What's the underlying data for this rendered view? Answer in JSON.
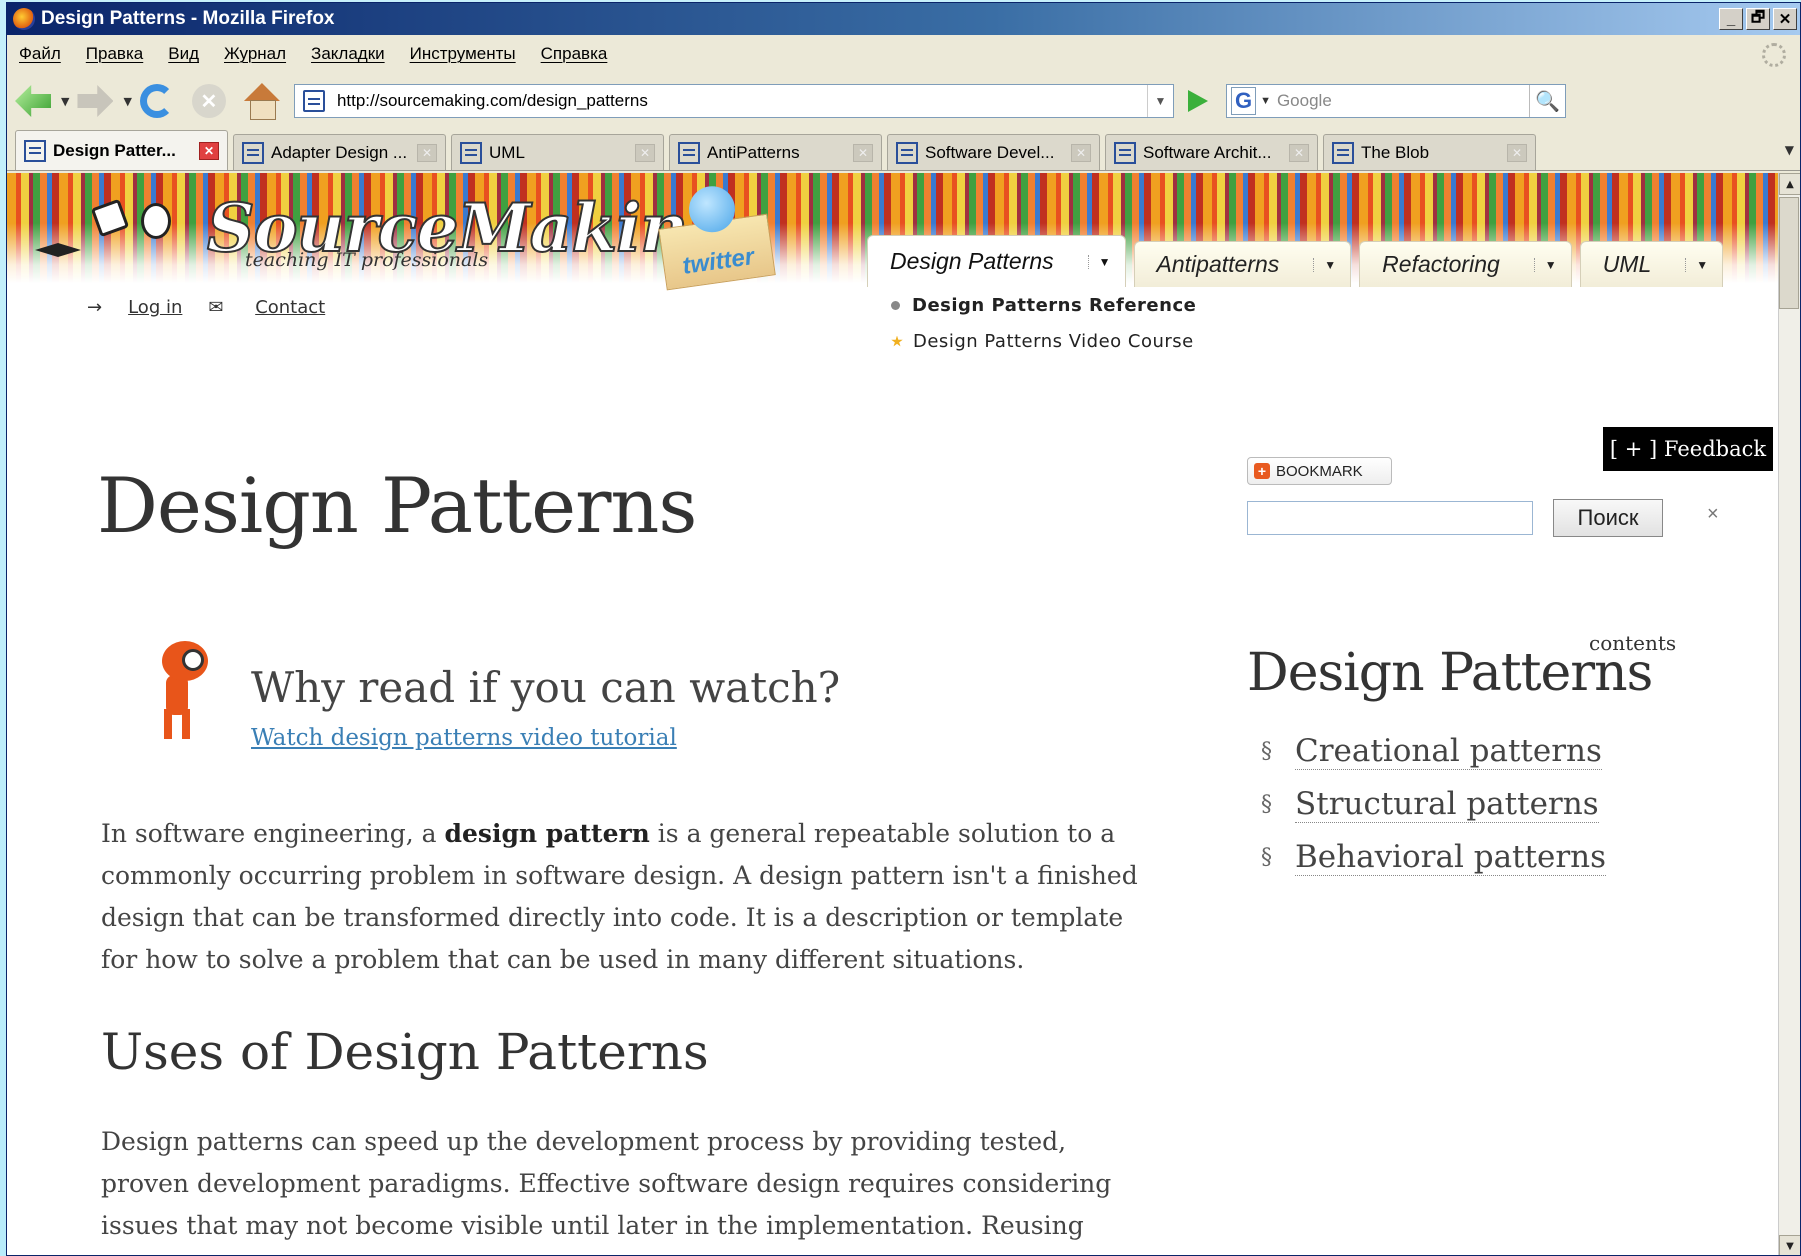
{
  "window": {
    "title": "Design Patterns - Mozilla Firefox",
    "buttons": {
      "minimize": "_",
      "maximize": "🗗",
      "close": "✕"
    }
  },
  "menu": [
    "Файл",
    "Правка",
    "Вид",
    "Журнал",
    "Закладки",
    "Инструменты",
    "Справка"
  ],
  "navbar": {
    "url": "http://sourcemaking.com/design_patterns",
    "search_placeholder": "Google",
    "search_engine_letter": "G"
  },
  "tabs": [
    {
      "label": "Design Patter...",
      "active": true
    },
    {
      "label": "Adapter Design ...",
      "active": false
    },
    {
      "label": "UML",
      "active": false
    },
    {
      "label": "AntiPatterns",
      "active": false
    },
    {
      "label": "Software Devel...",
      "active": false
    },
    {
      "label": "Software Archit...",
      "active": false
    },
    {
      "label": "The Blob",
      "active": false
    }
  ],
  "site": {
    "logo": "SourceMaking",
    "tagline": "teaching IT professionals",
    "twitter": "twitter",
    "nav": [
      "Design Patterns",
      "Antipatterns",
      "Refactoring",
      "UML"
    ],
    "login": "Log in",
    "contact": "Contact",
    "subnav": [
      "Design Patterns Reference",
      "Design Patterns Video Course"
    ]
  },
  "page": {
    "title": "Design Patterns",
    "watch_heading": "Why read if you can watch?",
    "watch_link": "Watch design patterns video tutorial",
    "p1_pre": "In software engineering, a ",
    "p1_bold": "design pattern",
    "p1_post": " is a general repeatable solution to a commonly occurring problem in software design. A design pattern isn't a finished design that can be transformed directly into code. It is a description or template for how to solve a problem that can be used in many different situations.",
    "uses_heading": "Uses of Design Patterns",
    "p2": "Design patterns can speed up the development process by providing tested, proven development paradigms. Effective software design requires considering issues that may not become visible until later in the implementation. Reusing design patterns"
  },
  "sidebar": {
    "feedback": "[ + ] Feedback",
    "bookmark": "BOOKMARK",
    "search_button": "Поиск",
    "close": "×",
    "contents_label": "contents",
    "heading": "Design Patterns",
    "toc": [
      "Creational patterns",
      "Structural patterns",
      "Behavioral patterns"
    ],
    "toc_marker": "§"
  }
}
